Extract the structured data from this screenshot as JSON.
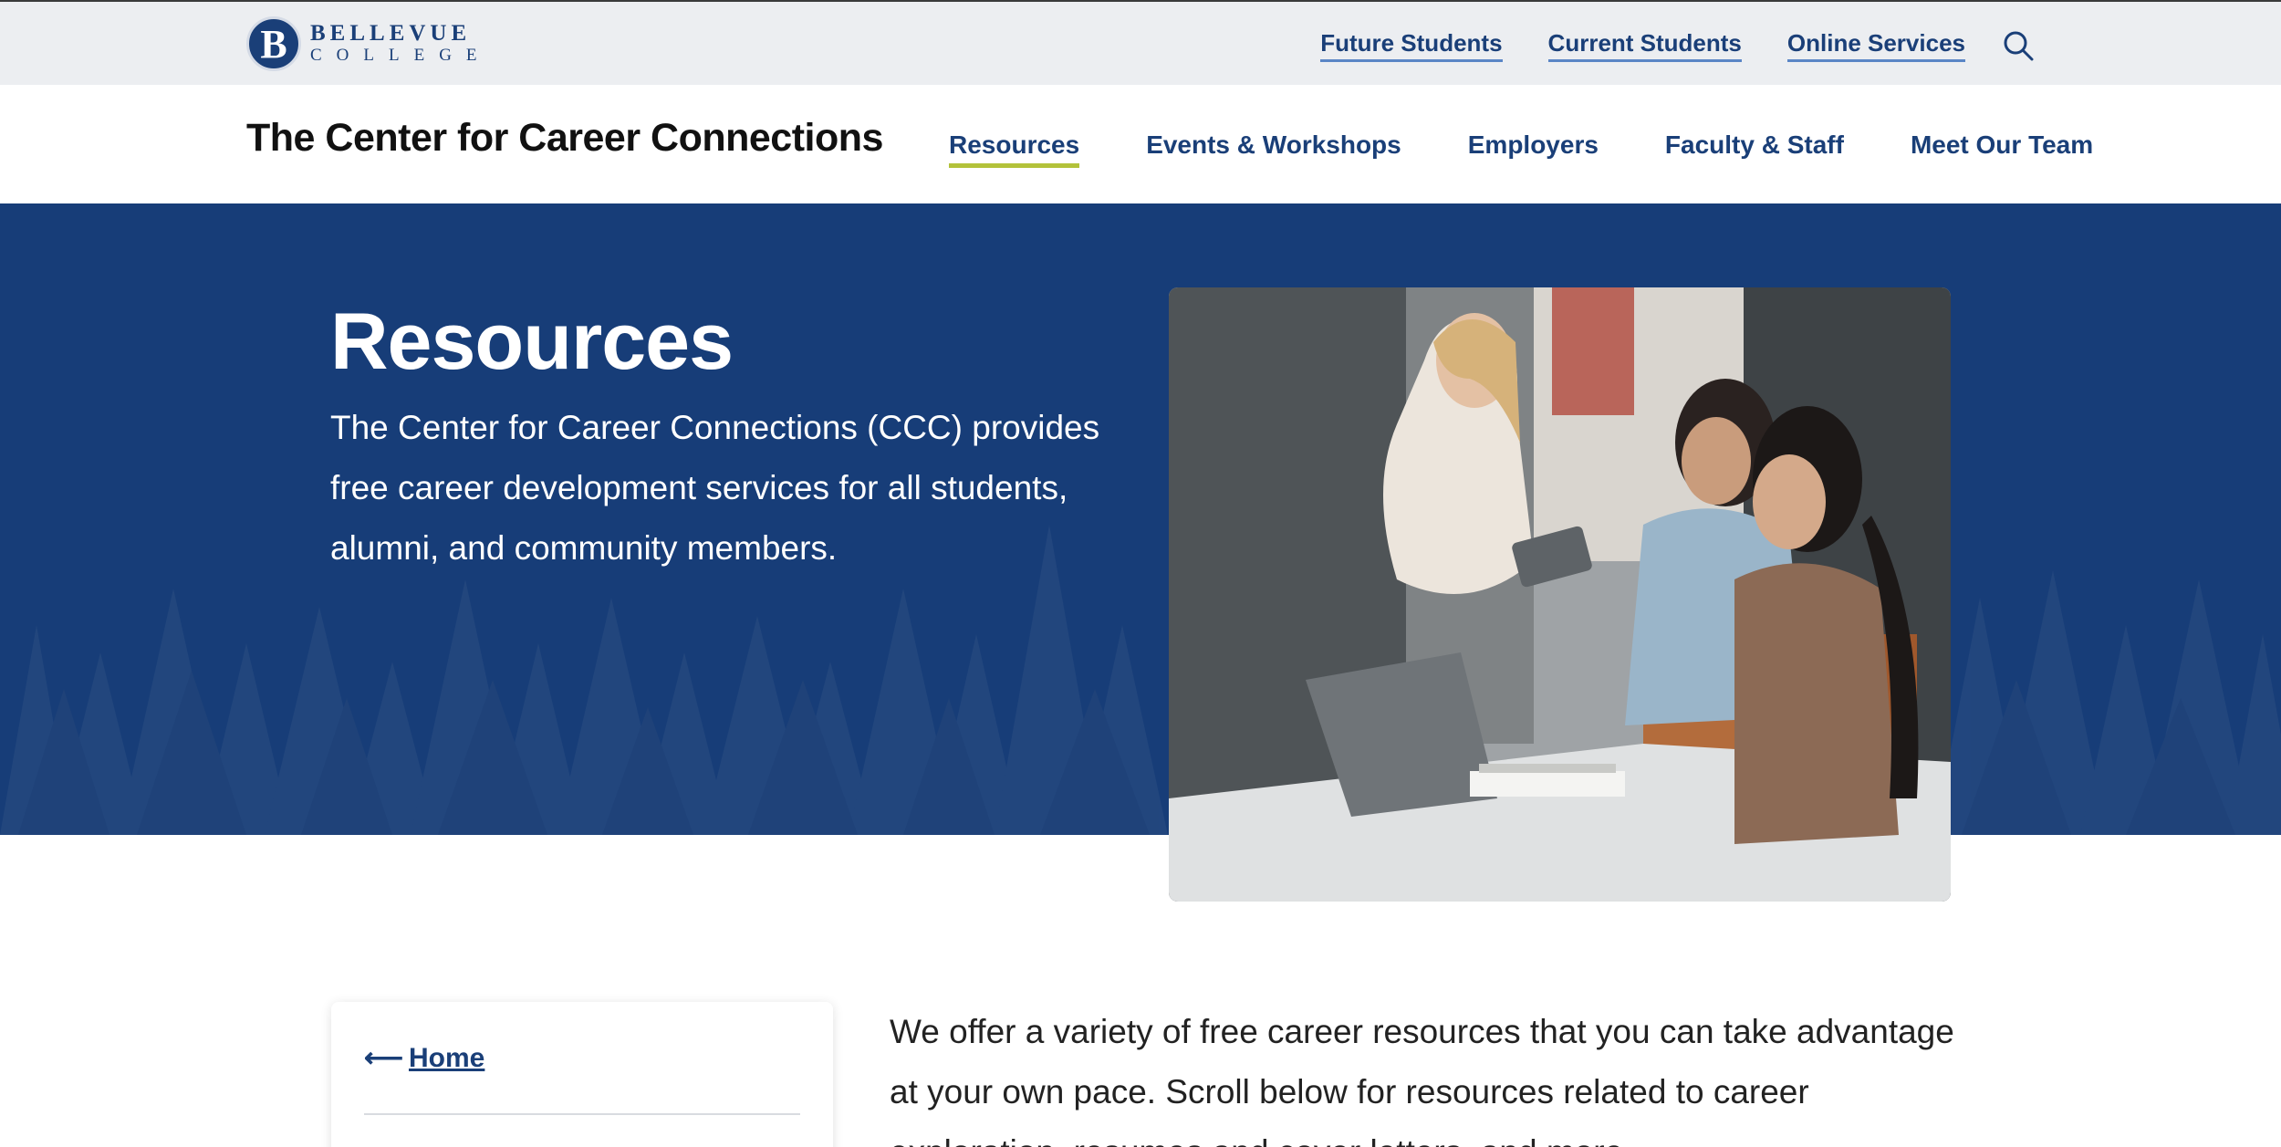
{
  "logo": {
    "mark": "B",
    "line1": "BELLEVUE",
    "line2": "COLLEGE"
  },
  "utility_nav": {
    "links": [
      "Future Students",
      "Current Students",
      "Online Services"
    ],
    "search_icon": "search-icon"
  },
  "site": {
    "title": "The Center for Career Connections"
  },
  "main_nav": {
    "items": [
      "Resources",
      "Events & Workshops",
      "Employers",
      "Faculty & Staff",
      "Meet Our Team"
    ],
    "active": "Resources",
    "accent": "#b3c23a"
  },
  "hero": {
    "title": "Resources",
    "text": "The Center for Career Connections (CCC) provides free career development services for all students, alumni, and community members.",
    "background": "#173d78"
  },
  "sidebar": {
    "home_arrow": "⟵",
    "home_label": "Home"
  },
  "intro": {
    "text": "We offer a variety of free career resources that you can take advantage at your own pace. Scroll below for resources related to career exploration, resumes and cover letters, and more."
  },
  "colors": {
    "brand": "#1a3f78",
    "topbar_bg": "#eceef1"
  }
}
